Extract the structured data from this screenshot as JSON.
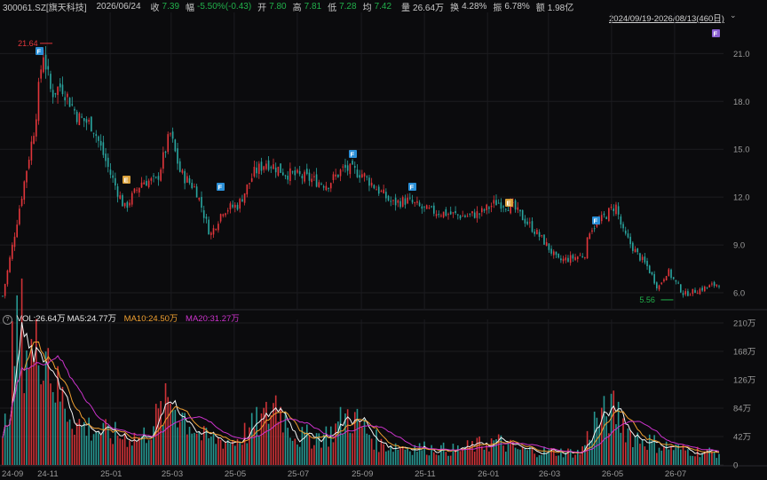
{
  "header": {
    "symbol": "300061.SZ[旗天科技]",
    "date": "2026/06/24",
    "close_label": "收",
    "close": "7.39",
    "change_label": "幅",
    "change": "-5.50%(-0.43)",
    "open_label": "开",
    "open": "7.80",
    "high_label": "高",
    "high": "7.81",
    "low_label": "低",
    "low": "7.28",
    "avg_label": "均",
    "avg": "7.42",
    "volume_label": "量",
    "volume": "26.64万",
    "turnover_label": "换",
    "turnover": "4.28%",
    "amplitude_label": "振",
    "amplitude": "6.78%",
    "amount_label": "额",
    "amount": "1.98亿"
  },
  "range_selector": {
    "label": "2024/09/19-2026/08/13(460日)",
    "caret": "⌄"
  },
  "volume_legend": {
    "icon": "?",
    "vol": "VOL:26.64万",
    "ma5": "MA5:24.77万",
    "ma10": "MA10:24.50万",
    "ma20": "MA20:31.27万"
  },
  "colors": {
    "up": "#e2363b",
    "down": "#2aa6a0",
    "ma5": "#f2f2f2",
    "ma10": "#f0a030",
    "ma20": "#cc33cc",
    "background": "#0b0b0d",
    "marker_f": "#2b8fd6",
    "marker_e": "#d9a03a",
    "marker_purple": "#8a5fd1"
  },
  "chart_data": [
    {
      "type": "candlestick",
      "title": "",
      "y_ticks": [
        "21.0",
        "18.0",
        "15.0",
        "12.0",
        "9.0",
        "6.0"
      ],
      "ylim": [
        5.0,
        22.8
      ],
      "x_ticks": [
        "24-09",
        "24-11",
        "25-01",
        "25-03",
        "25-05",
        "25-07",
        "25-09",
        "25-11",
        "26-01",
        "26-03",
        "26-05",
        "26-07"
      ],
      "annotations": [
        {
          "text": "21.64",
          "kind": "max",
          "x_date": "24-11",
          "value": 21.64
        },
        {
          "text": "5.56",
          "kind": "min",
          "x_date": "26-06",
          "value": 5.56
        }
      ],
      "event_markers": [
        {
          "label": "F",
          "approx_date": "24-10",
          "kind": "F"
        },
        {
          "label": "E",
          "approx_date": "25-01",
          "kind": "E"
        },
        {
          "label": "F",
          "approx_date": "25-04",
          "kind": "F"
        },
        {
          "label": "F",
          "approx_date": "25-08",
          "kind": "F"
        },
        {
          "label": "F",
          "approx_date": "25-10",
          "kind": "F"
        },
        {
          "label": "E",
          "approx_date": "26-01",
          "kind": "E"
        },
        {
          "label": "F",
          "approx_date": "26-04",
          "kind": "F"
        },
        {
          "label": "F",
          "approx_date": "26-08",
          "kind": "purple"
        }
      ],
      "price_path_keypoints": [
        [
          "24-09-19",
          5.8
        ],
        [
          "24-09-30",
          9.5
        ],
        [
          "24-10-10",
          13.0
        ],
        [
          "24-10-20",
          16.5
        ],
        [
          "24-10-28",
          21.2
        ],
        [
          "24-11-05",
          18.5
        ],
        [
          "24-11-15",
          19.0
        ],
        [
          "24-12-01",
          17.0
        ],
        [
          "24-12-15",
          16.5
        ],
        [
          "25-01-01",
          13.5
        ],
        [
          "25-01-15",
          11.3
        ],
        [
          "25-02-01",
          13.0
        ],
        [
          "25-02-15",
          13.0
        ],
        [
          "25-02-28",
          16.0
        ],
        [
          "25-03-10",
          13.5
        ],
        [
          "25-03-25",
          12.5
        ],
        [
          "25-04-08",
          9.6
        ],
        [
          "25-04-20",
          11.2
        ],
        [
          "25-05-05",
          11.5
        ],
        [
          "25-05-20",
          13.5
        ],
        [
          "25-06-01",
          14.2
        ],
        [
          "25-06-20",
          13.5
        ],
        [
          "25-07-10",
          13.2
        ],
        [
          "25-07-30",
          12.8
        ],
        [
          "25-08-15",
          13.8
        ],
        [
          "25-09-01",
          13.5
        ],
        [
          "25-09-15",
          12.6
        ],
        [
          "25-10-01",
          11.6
        ],
        [
          "25-10-15",
          11.8
        ],
        [
          "25-11-01",
          11.2
        ],
        [
          "25-11-20",
          11.0
        ],
        [
          "25-12-10",
          10.8
        ],
        [
          "25-12-25",
          11.0
        ],
        [
          "26-01-10",
          11.7
        ],
        [
          "26-01-25",
          11.4
        ],
        [
          "26-02-10",
          10.3
        ],
        [
          "26-02-25",
          9.2
        ],
        [
          "26-03-10",
          8.0
        ],
        [
          "26-03-25",
          8.2
        ],
        [
          "26-04-05",
          8.4
        ],
        [
          "26-04-10",
          10.0
        ],
        [
          "26-04-20",
          10.5
        ],
        [
          "26-05-05",
          11.5
        ],
        [
          "26-05-12",
          9.8
        ],
        [
          "26-05-25",
          8.5
        ],
        [
          "26-06-05",
          7.6
        ],
        [
          "26-06-15",
          6.3
        ],
        [
          "26-06-24",
          7.39
        ],
        [
          "26-07-10",
          5.9
        ],
        [
          "26-07-25",
          6.2
        ],
        [
          "26-08-13",
          6.6
        ]
      ]
    },
    {
      "type": "bar",
      "title": "VOL",
      "y_ticks": [
        "210万",
        "168万",
        "126万",
        "84万",
        "42万",
        "0"
      ],
      "ylim": [
        0,
        210
      ],
      "unit": "万",
      "series": [
        {
          "name": "MA5",
          "color": "#f2f2f2"
        },
        {
          "name": "MA10",
          "color": "#f0a030"
        },
        {
          "name": "MA20",
          "color": "#cc33cc"
        }
      ],
      "volume_keypoints": [
        [
          "24-09-19",
          30
        ],
        [
          "24-09-30",
          170
        ],
        [
          "24-10-08",
          200
        ],
        [
          "24-10-20",
          150
        ],
        [
          "24-10-28",
          210
        ],
        [
          "24-11-10",
          110
        ],
        [
          "24-12-01",
          60
        ],
        [
          "25-01-01",
          45
        ],
        [
          "25-02-01",
          40
        ],
        [
          "25-03-01",
          95
        ],
        [
          "25-04-01",
          40
        ],
        [
          "25-05-01",
          35
        ],
        [
          "25-06-01",
          70
        ],
        [
          "25-06-10",
          95
        ],
        [
          "25-07-01",
          40
        ],
        [
          "25-08-01",
          45
        ],
        [
          "25-08-20",
          75
        ],
        [
          "25-09-20",
          30
        ],
        [
          "25-11-01",
          25
        ],
        [
          "25-12-01",
          22
        ],
        [
          "26-01-10",
          35
        ],
        [
          "26-02-01",
          22
        ],
        [
          "26-03-01",
          20
        ],
        [
          "26-04-01",
          18
        ],
        [
          "26-04-15",
          65
        ],
        [
          "26-05-05",
          80
        ],
        [
          "26-05-20",
          45
        ],
        [
          "26-06-15",
          30
        ],
        [
          "26-07-10",
          22
        ],
        [
          "26-08-13",
          18
        ]
      ]
    }
  ]
}
